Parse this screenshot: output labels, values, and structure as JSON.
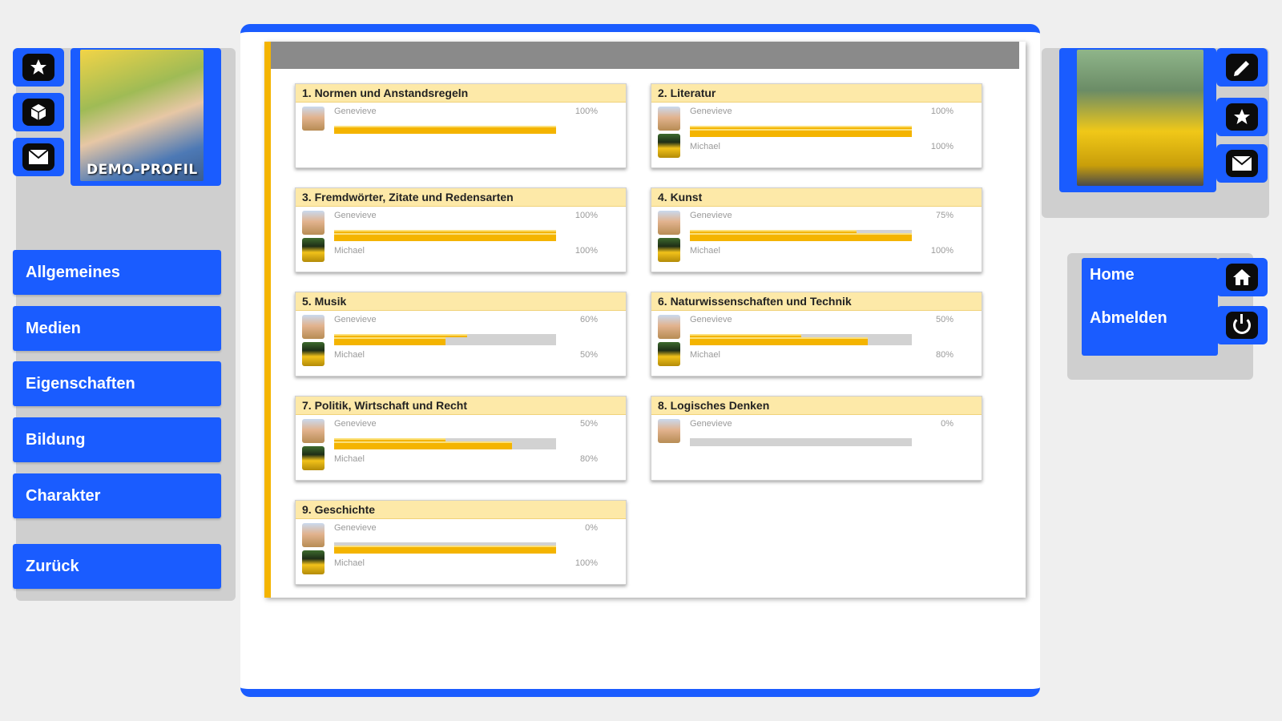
{
  "left_profile": {
    "photo_caption": "DEMO-PROFIL",
    "icons": [
      "star-icon",
      "cube-icon",
      "mail-icon"
    ]
  },
  "nav": {
    "items": [
      "Allgemeines",
      "Medien",
      "Eigenschaften",
      "Bildung",
      "Charakter"
    ],
    "back": "Zurück"
  },
  "right_profile": {
    "icons": [
      "pencil-icon",
      "star-icon",
      "mail-icon"
    ]
  },
  "right_menu": {
    "home": "Home",
    "logout": "Abmelden"
  },
  "colors": {
    "accent_blue": "#1a5cff",
    "bar_yellow": "#f4b400",
    "title_bg": "#fde9a8",
    "header_gray": "#8a8a8a"
  },
  "categories": [
    {
      "title": "1. Normen und Anstandsregeln",
      "entries": [
        {
          "name": "Genevieve",
          "percent_label": "100%",
          "value": 100
        }
      ]
    },
    {
      "title": "2. Literatur",
      "entries": [
        {
          "name": "Genevieve",
          "percent_label": "100%",
          "value": 100
        },
        {
          "name": "Michael",
          "percent_label": "100%",
          "value": 100
        }
      ]
    },
    {
      "title": "3. Fremdwörter, Zitate und Redensarten",
      "entries": [
        {
          "name": "Genevieve",
          "percent_label": "100%",
          "value": 100
        },
        {
          "name": "Michael",
          "percent_label": "100%",
          "value": 100
        }
      ]
    },
    {
      "title": "4. Kunst",
      "entries": [
        {
          "name": "Genevieve",
          "percent_label": "75%",
          "value": 75
        },
        {
          "name": "Michael",
          "percent_label": "100%",
          "value": 100
        }
      ]
    },
    {
      "title": "5. Musik",
      "entries": [
        {
          "name": "Genevieve",
          "percent_label": "60%",
          "value": 60
        },
        {
          "name": "Michael",
          "percent_label": "50%",
          "value": 50
        }
      ]
    },
    {
      "title": "6. Naturwissenschaften und Technik",
      "entries": [
        {
          "name": "Genevieve",
          "percent_label": "50%",
          "value": 50
        },
        {
          "name": "Michael",
          "percent_label": "80%",
          "value": 80
        }
      ]
    },
    {
      "title": "7. Politik, Wirtschaft und Recht",
      "entries": [
        {
          "name": "Genevieve",
          "percent_label": "50%",
          "value": 50
        },
        {
          "name": "Michael",
          "percent_label": "80%",
          "value": 80
        }
      ]
    },
    {
      "title": "8. Logisches Denken",
      "entries": [
        {
          "name": "Genevieve",
          "percent_label": "0%",
          "value": 0
        }
      ]
    },
    {
      "title": "9. Geschichte",
      "entries": [
        {
          "name": "Genevieve",
          "percent_label": "0%",
          "value": 0
        },
        {
          "name": "Michael",
          "percent_label": "100%",
          "value": 100
        }
      ]
    }
  ]
}
